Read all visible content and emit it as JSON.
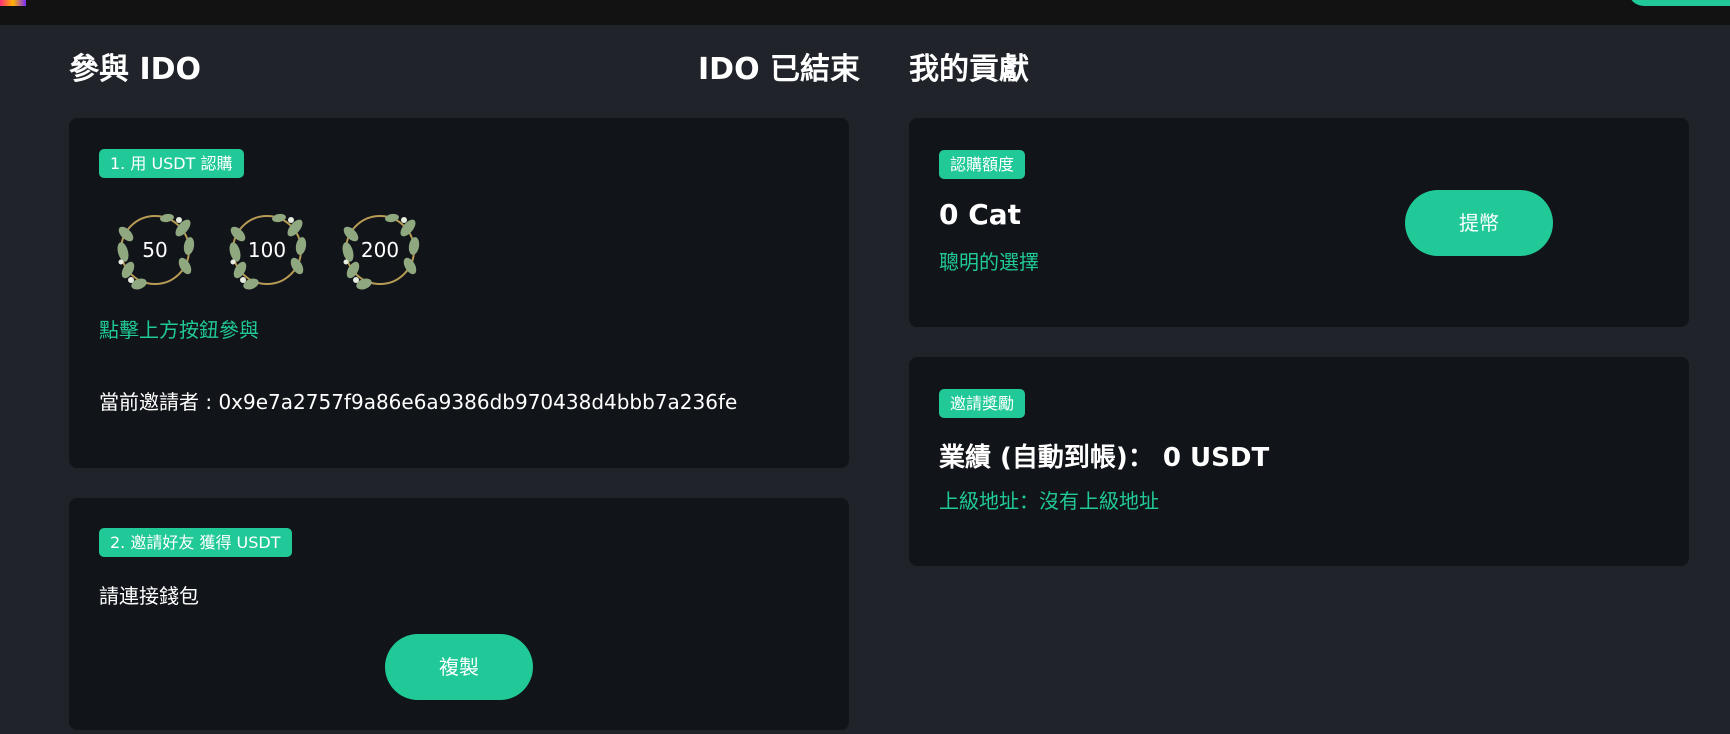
{
  "header": {
    "left_title": "參與 IDO",
    "ido_status": "IDO 已結束",
    "right_title": "我的貢獻"
  },
  "subscribe_card": {
    "badge": "1. 用 USDT 認購",
    "amounts": [
      "50",
      "100",
      "200"
    ],
    "hint": "點擊上方按鈕參與",
    "inviter_label": "當前邀請者 : ",
    "inviter_address": "0x9e7a2757f9a86e6a9386db970438d4bbb7a236fe"
  },
  "invite_card": {
    "badge": "2. 邀請好友 獲得 USDT",
    "message": "請連接錢包",
    "copy_button": "複製"
  },
  "quota_card": {
    "badge": "認購額度",
    "amount": "0 Cat",
    "note": "聰明的選擇",
    "withdraw_button": "提幣"
  },
  "reward_card": {
    "badge": "邀請獎勵",
    "performance_label": "業績 (自動到帳)：",
    "performance_value": "0 USDT",
    "upline_label": "上級地址：",
    "upline_value": "沒有上級地址"
  },
  "colors": {
    "accent": "#20c997",
    "background": "#202329",
    "card": "#111418",
    "topbar": "#121212"
  }
}
